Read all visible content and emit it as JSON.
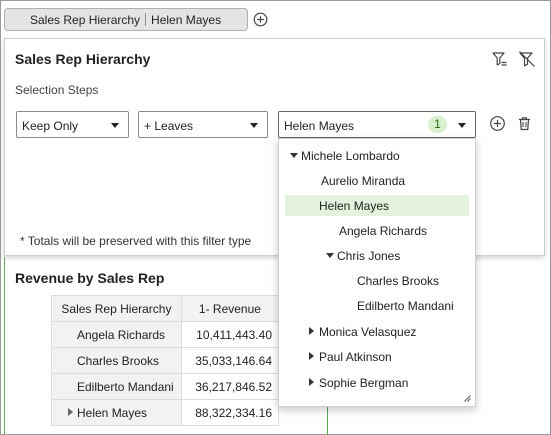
{
  "filter_chip": {
    "field": "Sales Rep Hierarchy",
    "value": "Helen Mayes"
  },
  "panel": {
    "title": "Sales Rep Hierarchy",
    "subtitle": "Selection Steps",
    "step": {
      "action": "Keep Only",
      "operator": "+ Leaves",
      "member": "Helen Mayes",
      "count": "1"
    },
    "note": "* Totals will be preserved with this filter type"
  },
  "report": {
    "title": "Revenue by Sales Rep",
    "columns": [
      "Sales Rep Hierarchy",
      "1- Revenue"
    ],
    "rows": [
      {
        "name": "Angela Richards",
        "revenue": "10,411,443.40"
      },
      {
        "name": "Charles Brooks",
        "revenue": "35,033,146.64"
      },
      {
        "name": "Edilberto Mandani",
        "revenue": "36,217,846.52"
      },
      {
        "name": "Helen Mayes",
        "revenue": "88,322,334.16"
      }
    ]
  },
  "tree": {
    "items": [
      {
        "label": "Michele Lombardo",
        "expanded": true
      },
      {
        "label": "Aurelio Miranda"
      },
      {
        "label": "Helen Mayes",
        "selected": true
      },
      {
        "label": "Angela Richards"
      },
      {
        "label": "Chris Jones",
        "expanded": true
      },
      {
        "label": "Charles Brooks"
      },
      {
        "label": "Edilberto Mandani"
      },
      {
        "label": "Monica Velasquez",
        "expanded": false
      },
      {
        "label": "Paul Atkinson",
        "expanded": false
      },
      {
        "label": "Sophie Bergman",
        "expanded": false
      }
    ]
  },
  "icons": {
    "add_filter": "plus-circle-icon",
    "clear_filter": "filter-clear-icon",
    "remove_filter": "filter-remove-icon",
    "add_step": "plus-circle-icon",
    "delete_step": "trash-icon"
  },
  "colors": {
    "selected_bg": "#e4f3dd",
    "badge_bg": "#d8f0cd",
    "accent_green": "#5aa85a"
  }
}
